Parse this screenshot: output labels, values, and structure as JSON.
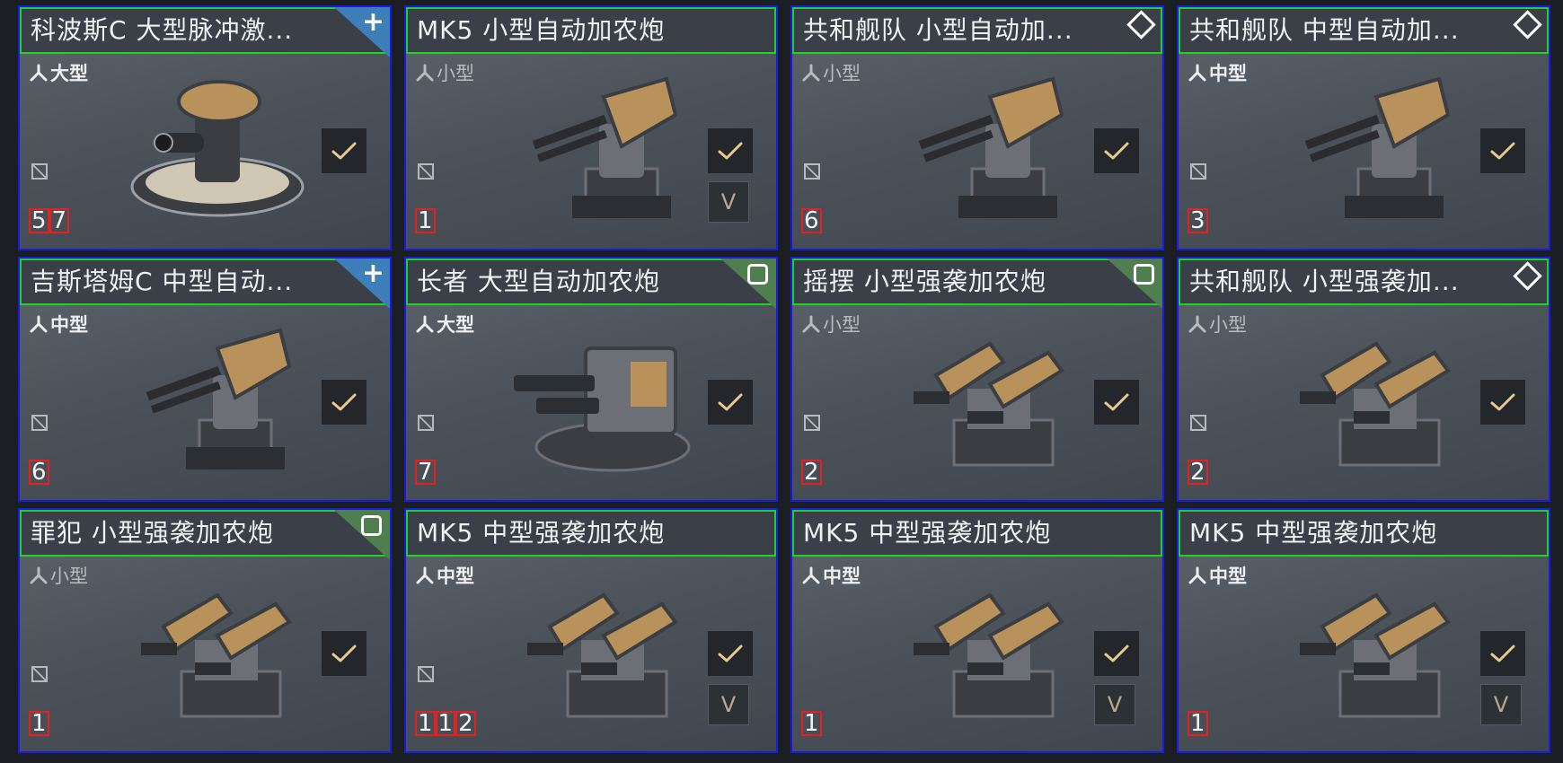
{
  "colors": {
    "card_border": "#1a1ae6",
    "title_border": "#21d321",
    "count_border": "#e62020",
    "corner_blue": "#3f7fb9",
    "corner_green": "#4f7f4f",
    "check_color": "#e8c98e",
    "gold": "#b8925a"
  },
  "cards": [
    {
      "title": "科波斯C 大型脉冲激...",
      "size": "大型",
      "size_bold": true,
      "count": "57",
      "corner": "plus",
      "corner_color": "blue",
      "show_lock": true,
      "show_v": false,
      "v_label": "",
      "weapon": "pulse-laser-icon"
    },
    {
      "title": "MK5 小型自动加农炮",
      "size": "小型",
      "size_bold": false,
      "count": "1",
      "corner": "none",
      "corner_color": "none",
      "show_lock": true,
      "show_v": true,
      "v_label": "V",
      "weapon": "autocannon-icon"
    },
    {
      "title": "共和舰队 小型自动加...",
      "size": "小型",
      "size_bold": false,
      "count": "6",
      "corner": "diamond",
      "corner_color": "none",
      "show_lock": true,
      "show_v": false,
      "v_label": "",
      "weapon": "autocannon-icon"
    },
    {
      "title": "共和舰队 中型自动加...",
      "size": "中型",
      "size_bold": true,
      "count": "3",
      "corner": "diamond",
      "corner_color": "none",
      "show_lock": true,
      "show_v": false,
      "v_label": "",
      "weapon": "medium-autocannon-icon"
    },
    {
      "title": "吉斯塔姆C 中型自动...",
      "size": "中型",
      "size_bold": true,
      "count": "6",
      "corner": "plus",
      "corner_color": "blue",
      "show_lock": true,
      "show_v": false,
      "v_label": "",
      "weapon": "medium-autocannon-icon"
    },
    {
      "title": "长者 大型自动加农炮",
      "size": "大型",
      "size_bold": true,
      "count": "7",
      "corner": "square",
      "corner_color": "green",
      "show_lock": true,
      "show_v": false,
      "v_label": "",
      "weapon": "large-autocannon-icon"
    },
    {
      "title": "摇摆 小型强袭加农炮",
      "size": "小型",
      "size_bold": false,
      "count": "2",
      "corner": "square",
      "corner_color": "green",
      "show_lock": true,
      "show_v": false,
      "v_label": "",
      "weapon": "assault-cannon-icon"
    },
    {
      "title": "共和舰队 小型强袭加...",
      "size": "小型",
      "size_bold": false,
      "count": "2",
      "corner": "diamond",
      "corner_color": "none",
      "show_lock": true,
      "show_v": false,
      "v_label": "",
      "weapon": "assault-cannon-icon"
    },
    {
      "title": "罪犯 小型强袭加农炮",
      "size": "小型",
      "size_bold": false,
      "count": "1",
      "corner": "square",
      "corner_color": "green",
      "show_lock": true,
      "show_v": false,
      "v_label": "",
      "weapon": "assault-cannon-icon"
    },
    {
      "title": "MK5 中型强袭加农炮",
      "size": "中型",
      "size_bold": true,
      "count": "112",
      "corner": "none",
      "corner_color": "none",
      "show_lock": true,
      "show_v": true,
      "v_label": "V",
      "weapon": "medium-assault-cannon-icon"
    },
    {
      "title": "MK5 中型强袭加农炮",
      "size": "中型",
      "size_bold": true,
      "count": "1",
      "corner": "none",
      "corner_color": "none",
      "show_lock": false,
      "show_v": true,
      "v_label": "V",
      "weapon": "medium-assault-cannon-icon"
    },
    {
      "title": "MK5 中型强袭加农炮",
      "size": "中型",
      "size_bold": true,
      "count": "1",
      "corner": "none",
      "corner_color": "none",
      "show_lock": false,
      "show_v": true,
      "v_label": "V",
      "weapon": "medium-assault-cannon-icon"
    }
  ]
}
